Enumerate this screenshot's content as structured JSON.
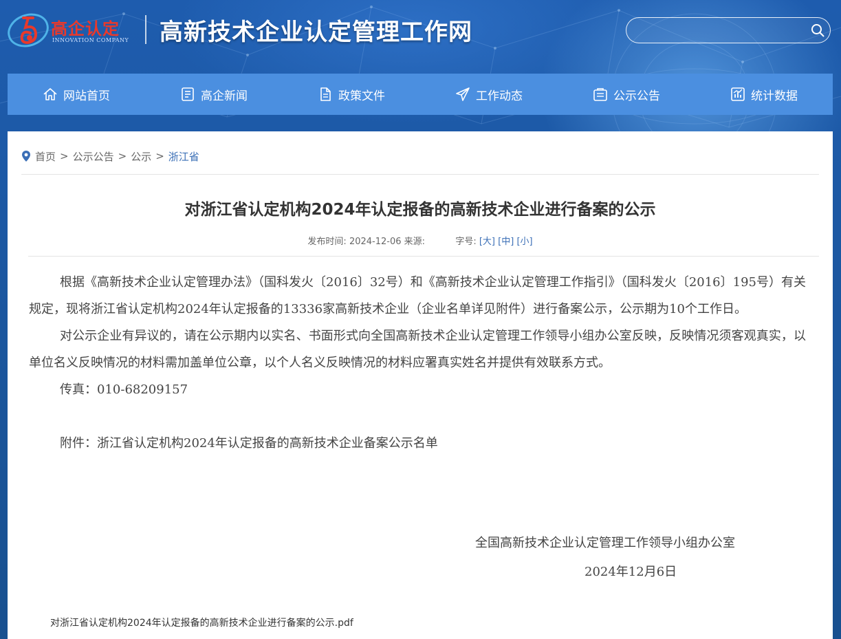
{
  "header": {
    "logo_cn": "高企认定",
    "logo_en": "INNOVATION COMPANY",
    "site_title": "高新技术企业认定管理工作网",
    "search_placeholder": ""
  },
  "nav": {
    "items": [
      {
        "label": "网站首页",
        "icon": "home-icon"
      },
      {
        "label": "高企新闻",
        "icon": "news-icon"
      },
      {
        "label": "政策文件",
        "icon": "document-icon"
      },
      {
        "label": "工作动态",
        "icon": "paper-plane-icon"
      },
      {
        "label": "公示公告",
        "icon": "notice-icon"
      },
      {
        "label": "统计数据",
        "icon": "chart-icon"
      }
    ]
  },
  "breadcrumb": {
    "items": [
      "首页",
      "公示公告",
      "公示",
      "浙江省"
    ],
    "separator": ">"
  },
  "article": {
    "title": "对浙江省认定机构2024年认定报备的高新技术企业进行备案的公示",
    "publish_label": "发布时间:",
    "publish_date": "2024-12-06",
    "source_label": "来源:",
    "source": "",
    "fontsize_label": "字号:",
    "fontsize_options": [
      "[大]",
      "[中]",
      "[小]"
    ],
    "paragraphs": [
      "根据《高新技术企业认定管理办法》（国科发火〔2016〕32号）和《高新技术企业认定管理工作指引》（国科发火〔2016〕195号）有关规定，现将浙江省认定机构2024年认定报备的13336家高新技术企业（企业名单详见附件）进行备案公示，公示期为10个工作日。",
      "对公示企业有异议的，请在公示期内以实名、书面形式向全国高新技术企业认定管理工作领导小组办公室反映，反映情况须客观真实，以单位名义反映情况的材料需加盖单位公章，以个人名义反映情况的材料应署真实姓名并提供有效联系方式。",
      "传真：010-68209157",
      "",
      "附件：浙江省认定机构2024年认定报备的高新技术企业备案公示名单"
    ],
    "signature_org": "全国高新技术企业认定管理工作领导小组办公室",
    "signature_date": "2024年12月6日",
    "attachment_file": "对浙江省认定机构2024年认定报备的高新技术企业进行备案的公示.pdf"
  },
  "colors": {
    "nav_bg": "#4b8fe0",
    "header_bg": "#1e5cae",
    "logo_red": "#e9392b",
    "link_blue": "#3b6fb6"
  }
}
